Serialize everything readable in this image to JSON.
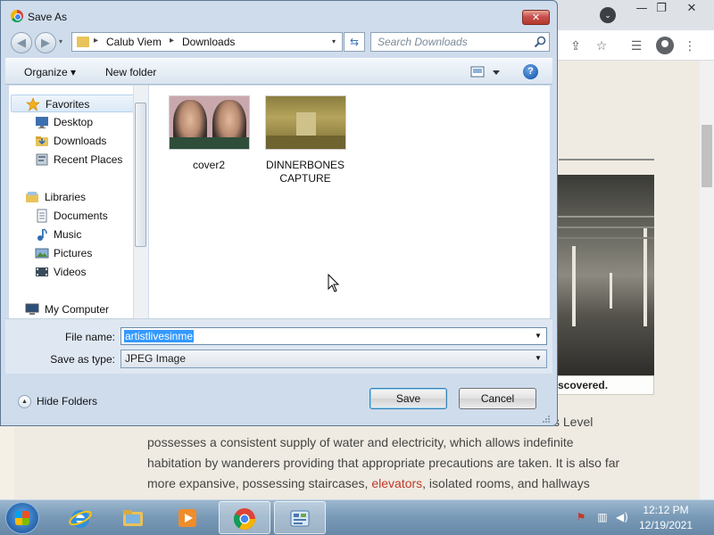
{
  "dialog": {
    "title": "Save As",
    "close_glyph": "✕",
    "nav": {
      "back_glyph": "◀",
      "forward_glyph": "▶",
      "recent_glyph": "▾"
    },
    "breadcrumb": [
      "Calub Viem",
      "Downloads"
    ],
    "breadcrumb_sep": "▸",
    "address_dropdown_glyph": "▾",
    "refresh_glyph": "⇆",
    "search_placeholder": "Search Downloads",
    "commands": {
      "organize": "Organize ▾",
      "new_folder": "New folder",
      "help": "?"
    },
    "nav_tree": [
      {
        "label": "Favorites",
        "icon": "star-icon",
        "selected": true
      },
      {
        "label": "Desktop",
        "icon": "desktop-icon"
      },
      {
        "label": "Downloads",
        "icon": "downloads-folder-icon"
      },
      {
        "label": "Recent Places",
        "icon": "recent-places-icon"
      },
      {
        "label": "Libraries",
        "icon": "libraries-icon"
      },
      {
        "label": "Documents",
        "icon": "documents-icon"
      },
      {
        "label": "Music",
        "icon": "music-icon"
      },
      {
        "label": "Pictures",
        "icon": "pictures-icon"
      },
      {
        "label": "Videos",
        "icon": "videos-icon"
      },
      {
        "label": "My Computer",
        "icon": "computer-icon"
      }
    ],
    "files": [
      {
        "name": "cover2"
      },
      {
        "name": "DINNERBONES CAPTURE"
      }
    ],
    "file_name_label": "File name:",
    "file_name_value": "artistlivesinme",
    "save_type_label": "Save as type:",
    "save_type_value": "JPEG Image",
    "dropdown_glyph": "▼",
    "hide_folders": "Hide Folders",
    "hide_folders_glyph": "▲",
    "save_button": "Save",
    "cancel_button": "Cancel"
  },
  "browser": {
    "window_controls": {
      "minimize": "—",
      "restore": "❐",
      "close": "✕"
    },
    "tab_search_glyph": "⌄",
    "toolbar_icons": {
      "share": "⇪",
      "bookmark": "☆",
      "reading_list": "☰",
      "menu": "⋮"
    },
    "page": {
      "caption": "scovered.",
      "side_fragment": "s Level",
      "lines": [
        "possesses a consistent supply of water and electricity, which allows indefinite",
        "habitation by wanderers providing that appropriate precautions are taken. It is also far"
      ],
      "line3_before": "more expansive, possessing staircases, ",
      "line3_link": "elevators",
      "line3_after": ", isolated rooms, and hallways"
    }
  },
  "taskbar": {
    "clock_time": "12:12 PM",
    "clock_date": "12/19/2021",
    "apps": [
      "internet-explorer",
      "file-explorer",
      "media-player",
      "chrome",
      "control-panel"
    ]
  },
  "colors": {
    "dialog_frame": "#cfdcec",
    "selection": "#3399ff",
    "link": "#c0392b",
    "taskbar": "#7a9bb8"
  }
}
